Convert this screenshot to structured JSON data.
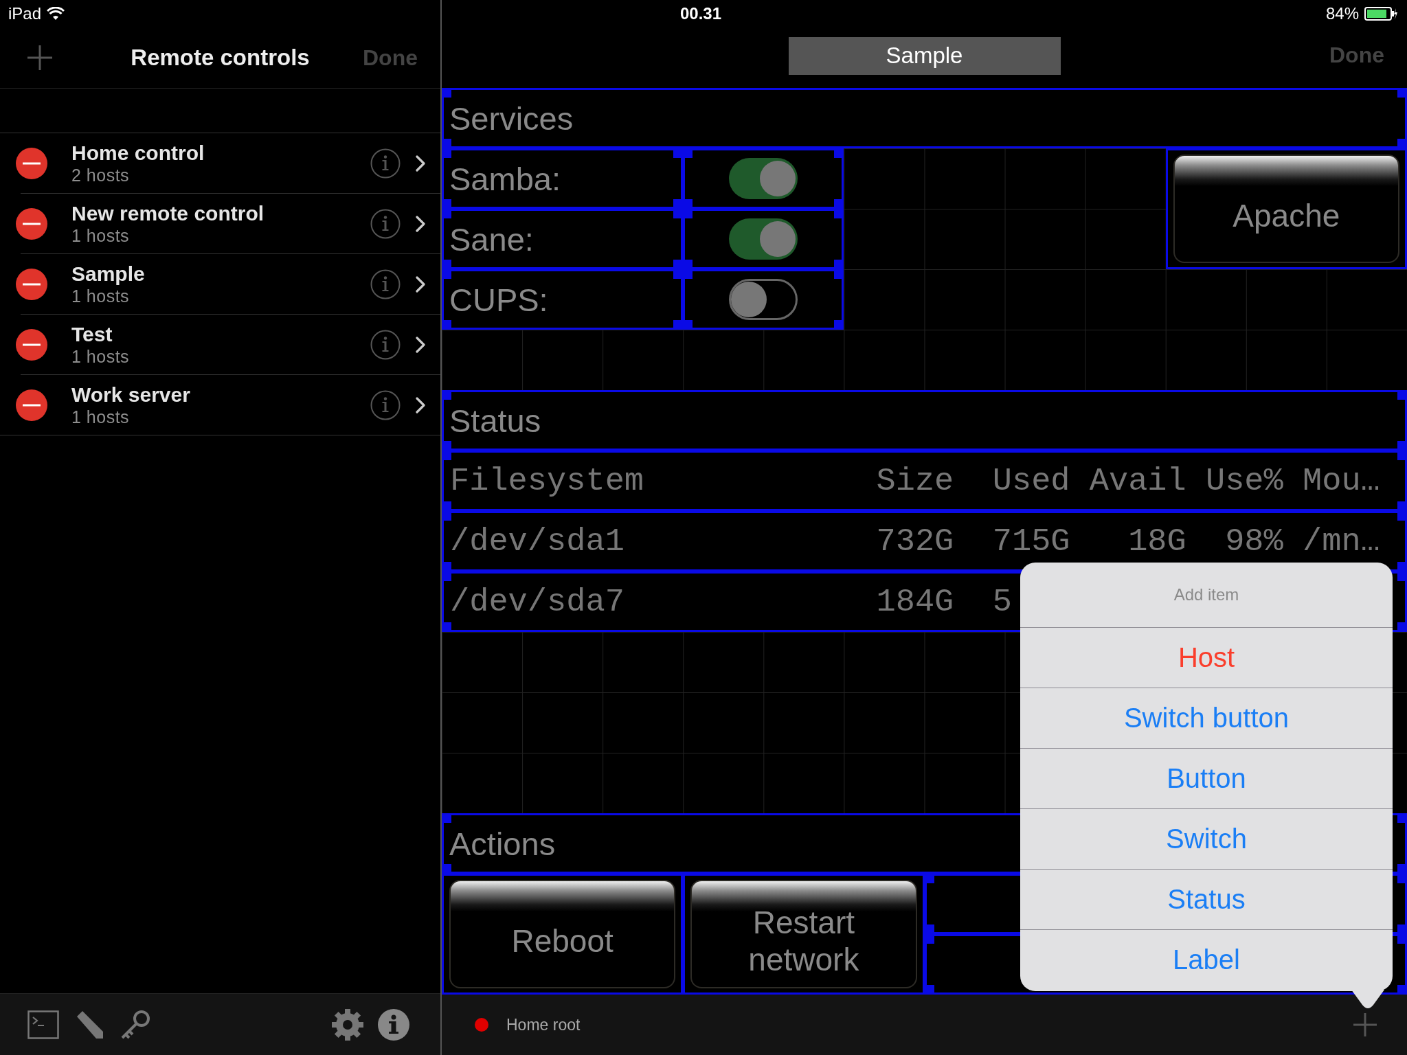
{
  "status_bar": {
    "device": "iPad",
    "time": "00.31",
    "battery": "84%"
  },
  "sidebar": {
    "title": "Remote controls",
    "done_button": "Done",
    "items": [
      {
        "title": "Home control",
        "subtitle": "2 hosts"
      },
      {
        "title": "New remote control",
        "subtitle": "1 hosts"
      },
      {
        "title": "Sample",
        "subtitle": "1 hosts"
      },
      {
        "title": "Test",
        "subtitle": "1 hosts"
      },
      {
        "title": "Work server",
        "subtitle": "1 hosts"
      }
    ]
  },
  "editor": {
    "title": "Sample",
    "done_button": "Done",
    "services": {
      "title": "Services",
      "switches": [
        {
          "label": "Samba:",
          "on": true
        },
        {
          "label": "Sane:",
          "on": true
        },
        {
          "label": "CUPS:",
          "on": false
        }
      ],
      "button": "Apache"
    },
    "status": {
      "title": "Status",
      "table": {
        "columns": [
          "Filesystem",
          "Size",
          "Used",
          "Avail",
          "Use%",
          "Mou…"
        ],
        "rows": [
          [
            "/dev/sda1",
            "732G",
            "715G",
            "18G",
            "98%",
            "/mn…"
          ],
          [
            "/dev/sda7",
            "184G",
            "5"
          ]
        ]
      }
    },
    "actions": {
      "title": "Actions",
      "buttons": [
        "Reboot",
        "Restart network"
      ]
    }
  },
  "bottom_bar": {
    "host": "Home root",
    "connected": false
  },
  "popover": {
    "title": "Add item",
    "items": [
      {
        "label": "Host",
        "kind": "destructive"
      },
      {
        "label": "Switch button",
        "kind": "default"
      },
      {
        "label": "Button",
        "kind": "default"
      },
      {
        "label": "Switch",
        "kind": "default"
      },
      {
        "label": "Status",
        "kind": "default"
      },
      {
        "label": "Label",
        "kind": "default"
      }
    ]
  }
}
